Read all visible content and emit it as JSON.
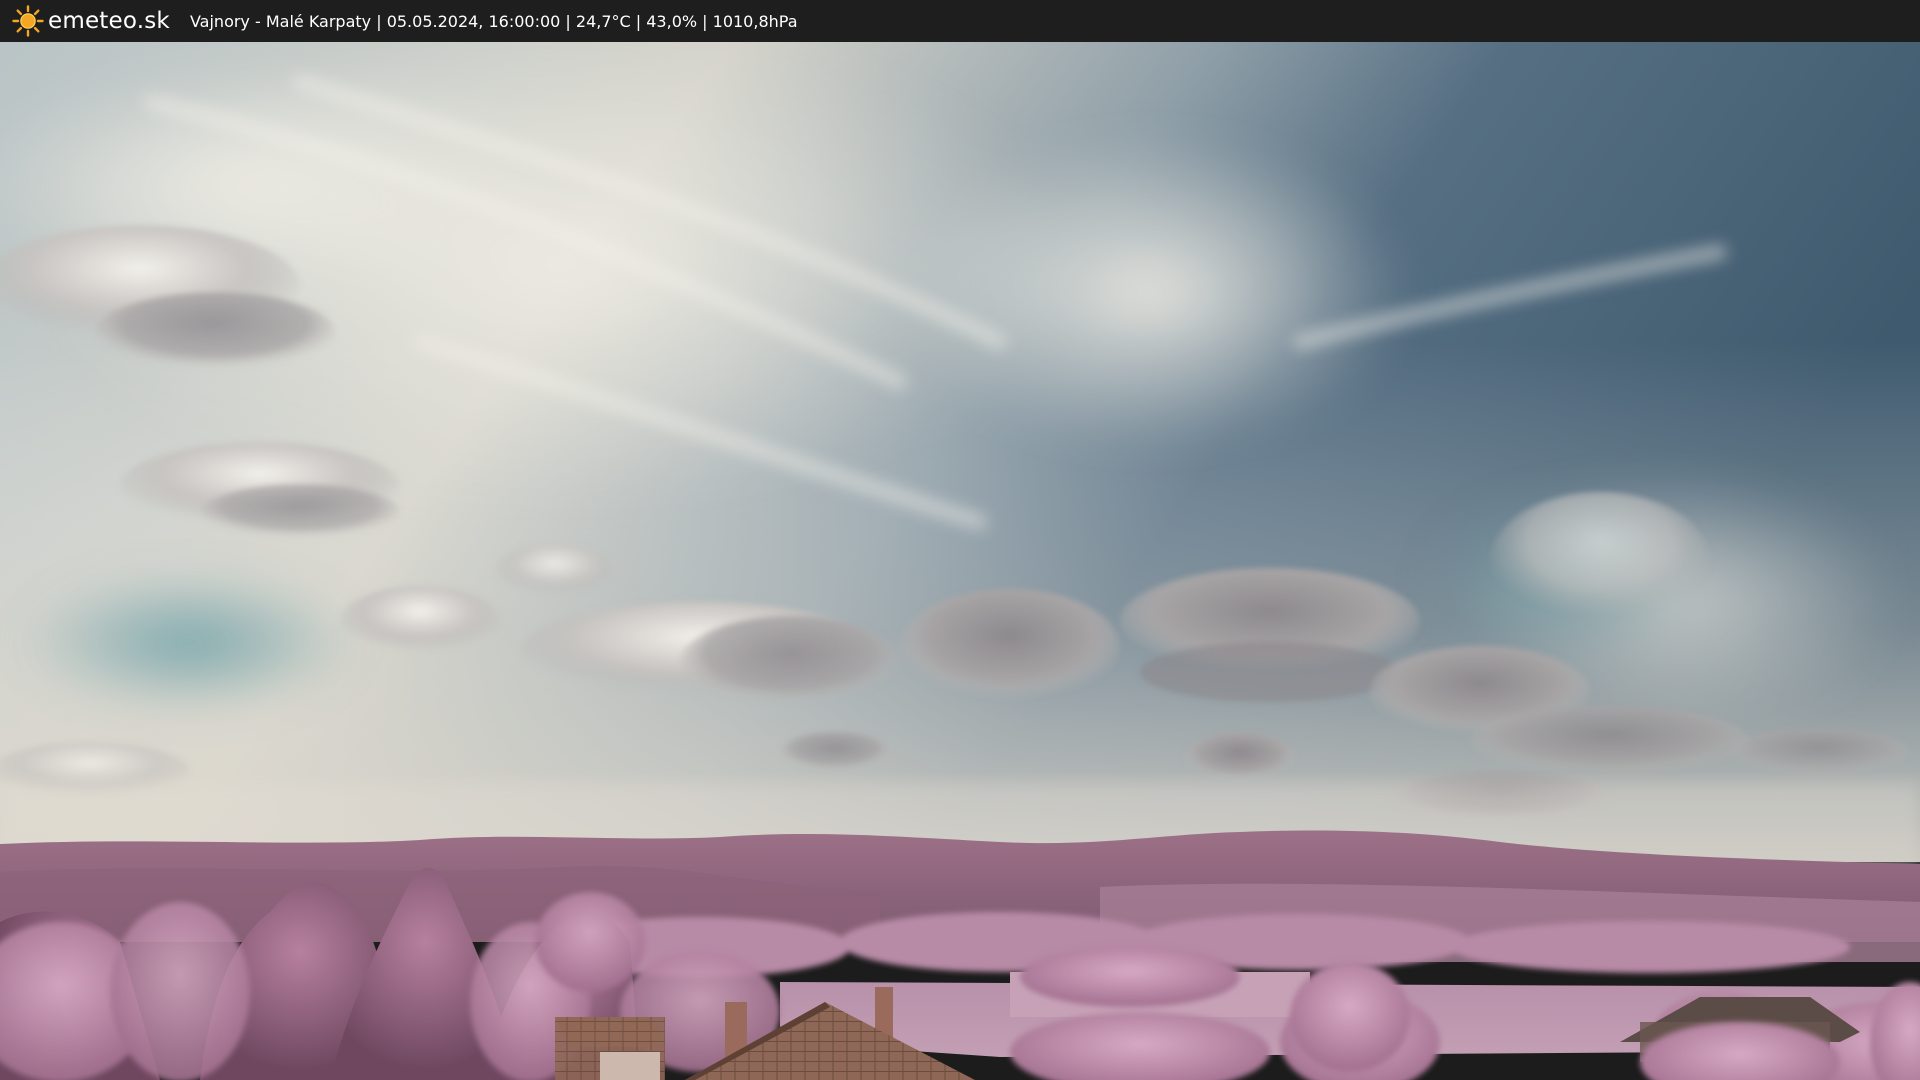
{
  "header": {
    "brand": "emeteo.sk",
    "caption": "Vajnory - Malé Karpaty | 05.05.2024, 16:00:00 | 24,7°C | 43,0% | 1010,8hPa",
    "logo_icon": "sun-icon",
    "logo_color": "#f5a623"
  },
  "webcam": {
    "scene_icon": "webcam-landscape-image",
    "sky_color": "#4f6f86",
    "cloud_color": "#d9d8d0",
    "vegetation_color": "#b07a9a"
  }
}
